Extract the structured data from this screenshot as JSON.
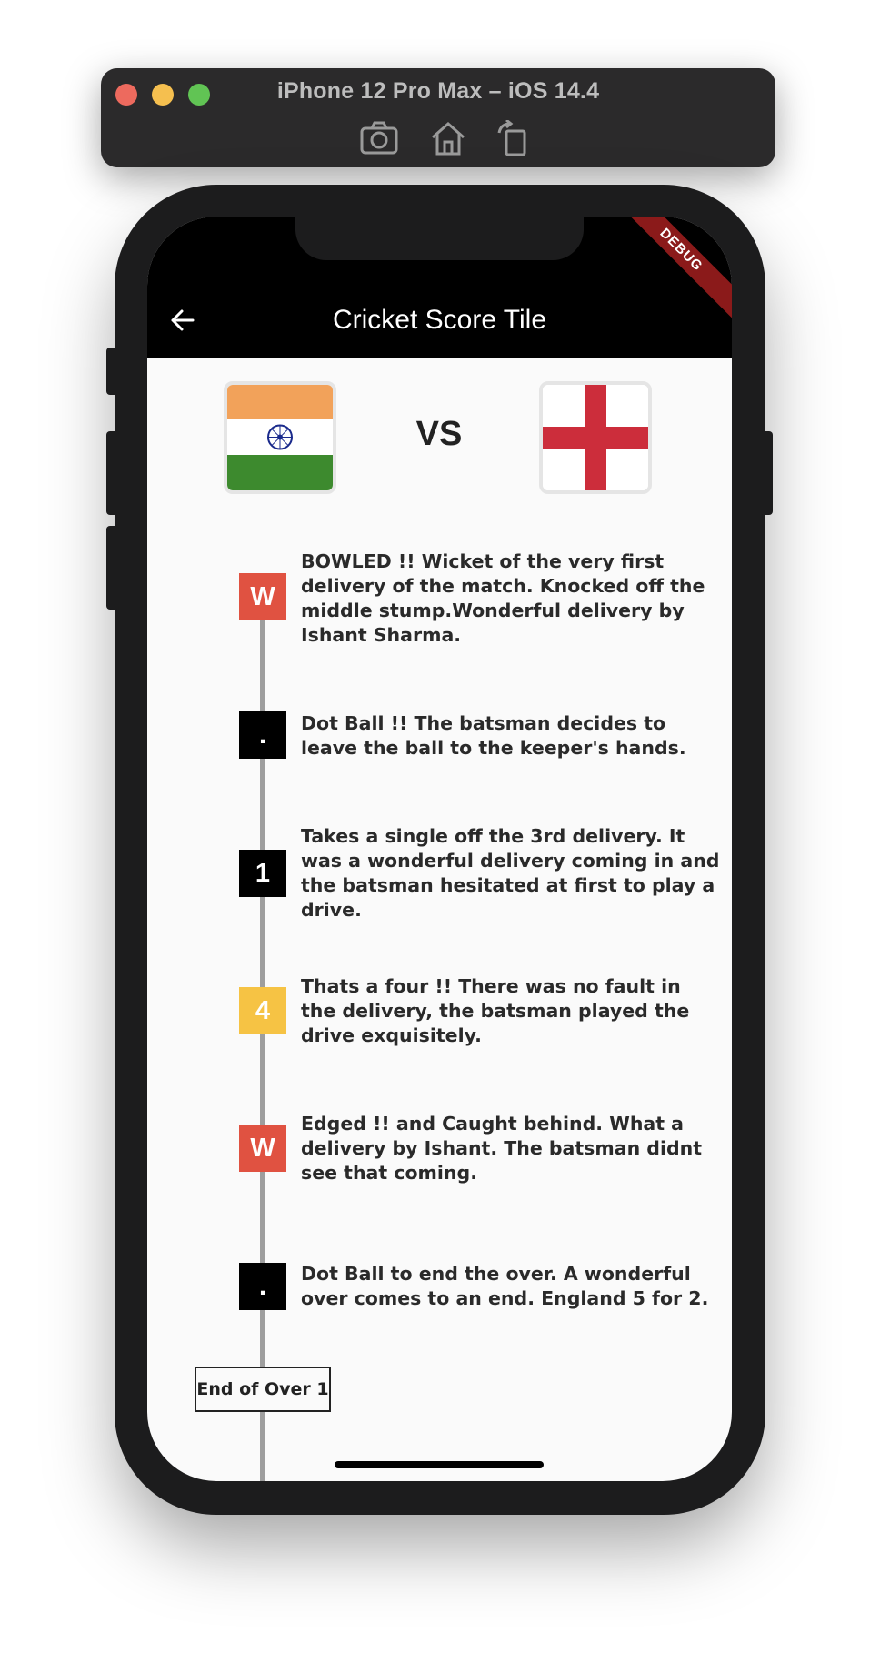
{
  "simulator": {
    "title": "iPhone 12 Pro Max – iOS 14.4",
    "tools": [
      {
        "icon": "camera-icon"
      },
      {
        "icon": "home-icon"
      },
      {
        "icon": "rotate-icon"
      }
    ]
  },
  "debug_banner": "DEBUG",
  "appbar": {
    "title": "Cricket Score Tile",
    "back_icon": "arrow-back-icon"
  },
  "match": {
    "team_a_flag": "india-flag",
    "vs": "VS",
    "team_b_flag": "england-flag"
  },
  "colors": {
    "wicket": "#e05241",
    "dot": "#000000",
    "run": "#000000",
    "four": "#f6c344",
    "timeline": "#9e9e9e"
  },
  "deliveries": [
    {
      "ball": "W",
      "type": "wicket",
      "text": "BOWLED !! Wicket of the very first delivery of the match. Knocked off the middle stump.Wonderful delivery by Ishant Sharma."
    },
    {
      "ball": ".",
      "type": "dot",
      "text": "Dot Ball !! The batsman decides to leave the ball to the keeper's hands."
    },
    {
      "ball": "1",
      "type": "run",
      "text": "Takes a single off the 3rd delivery. It was a wonderful delivery coming in and the batsman hesitated at first to play a drive."
    },
    {
      "ball": "4",
      "type": "four",
      "text": "Thats a four !! There was no fault in the delivery, the batsman played the drive exquisitely."
    },
    {
      "ball": "W",
      "type": "wicket",
      "text": "Edged !! and Caught behind. What a delivery by Ishant. The batsman didnt see that coming."
    },
    {
      "ball": ".",
      "type": "dot",
      "text": "Dot Ball to end the over. A wonderful over comes to an end. England 5 for 2."
    }
  ],
  "end_of_over": "End of Over 1"
}
